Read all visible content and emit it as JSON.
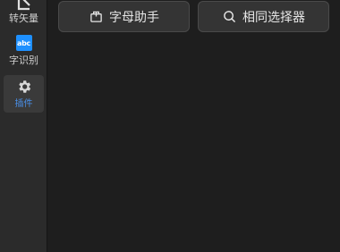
{
  "sidebar": {
    "items": [
      {
        "label": "转矢量",
        "icon": "vector-icon"
      },
      {
        "label": "字识别",
        "icon": "ocr-abc-icon",
        "icon_text": "abc",
        "icon_color": "#1e90ff"
      },
      {
        "label": "插件",
        "icon": "gear-icon",
        "active": true,
        "active_color": "#4a8fe7"
      }
    ]
  },
  "toolbar": {
    "buttons": [
      {
        "label": "字母助手",
        "icon": "package-icon"
      },
      {
        "label": "相同选择器",
        "icon": "search-icon"
      }
    ]
  },
  "colors": {
    "background": "#1e1e1e",
    "sidebar": "#2b2b2b",
    "button": "#343434",
    "accent": "#1e90ff"
  }
}
